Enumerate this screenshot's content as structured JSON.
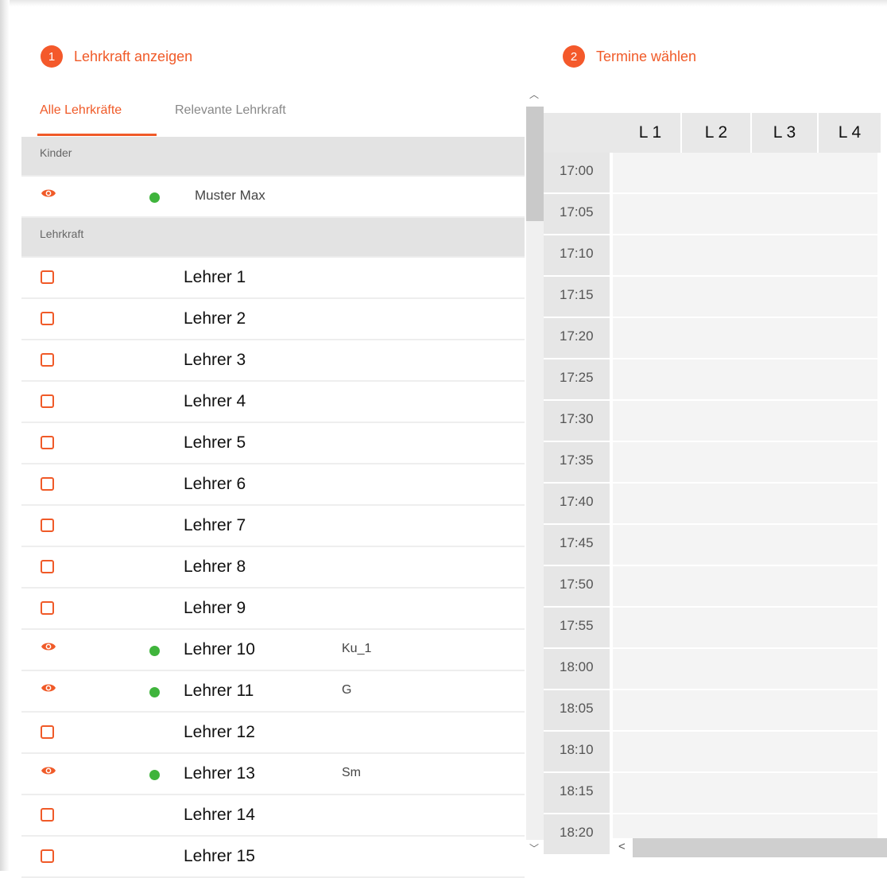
{
  "steps": [
    {
      "number": "1",
      "label": "Lehrkraft anzeigen"
    },
    {
      "number": "2",
      "label": "Termine wählen"
    }
  ],
  "tabs": {
    "all": "Alle Lehrkräfte",
    "relevant": "Relevante Lehrkraft"
  },
  "groups": {
    "kinder": {
      "label": "Kinder",
      "rows": [
        {
          "name": "Muster Max",
          "shown": true,
          "code": ""
        }
      ]
    },
    "lehrkraft": {
      "label": "Lehrkraft",
      "rows": [
        {
          "name": "Lehrer 1",
          "shown": false,
          "code": ""
        },
        {
          "name": "Lehrer 2",
          "shown": false,
          "code": ""
        },
        {
          "name": "Lehrer 3",
          "shown": false,
          "code": ""
        },
        {
          "name": "Lehrer 4",
          "shown": false,
          "code": ""
        },
        {
          "name": "Lehrer 5",
          "shown": false,
          "code": ""
        },
        {
          "name": "Lehrer 6",
          "shown": false,
          "code": ""
        },
        {
          "name": "Lehrer 7",
          "shown": false,
          "code": ""
        },
        {
          "name": "Lehrer 8",
          "shown": false,
          "code": ""
        },
        {
          "name": "Lehrer 9",
          "shown": false,
          "code": ""
        },
        {
          "name": "Lehrer 10",
          "shown": true,
          "code": "Ku_1"
        },
        {
          "name": "Lehrer 11",
          "shown": true,
          "code": "G"
        },
        {
          "name": "Lehrer 12",
          "shown": false,
          "code": ""
        },
        {
          "name": "Lehrer 13",
          "shown": true,
          "code": "Sm"
        },
        {
          "name": "Lehrer 14",
          "shown": false,
          "code": ""
        },
        {
          "name": "Lehrer 15",
          "shown": false,
          "code": ""
        }
      ]
    }
  },
  "schedule": {
    "columns": [
      "L 1",
      "L 2",
      "L 3",
      "L 4"
    ],
    "times": [
      "17:00",
      "17:05",
      "17:10",
      "17:15",
      "17:20",
      "17:25",
      "17:30",
      "17:35",
      "17:40",
      "17:45",
      "17:50",
      "17:55",
      "18:00",
      "18:05",
      "18:10",
      "18:15",
      "18:20"
    ]
  },
  "icons": {
    "eye": "eye-icon",
    "checkbox": "checkbox-icon",
    "status_dot": "status-dot-icon",
    "scroll_up": "chevron-up-icon",
    "scroll_down": "chevron-down-icon",
    "scroll_left": "chevron-left-icon"
  },
  "colors": {
    "accent": "#f05a28",
    "status_green": "#3fb43c"
  }
}
